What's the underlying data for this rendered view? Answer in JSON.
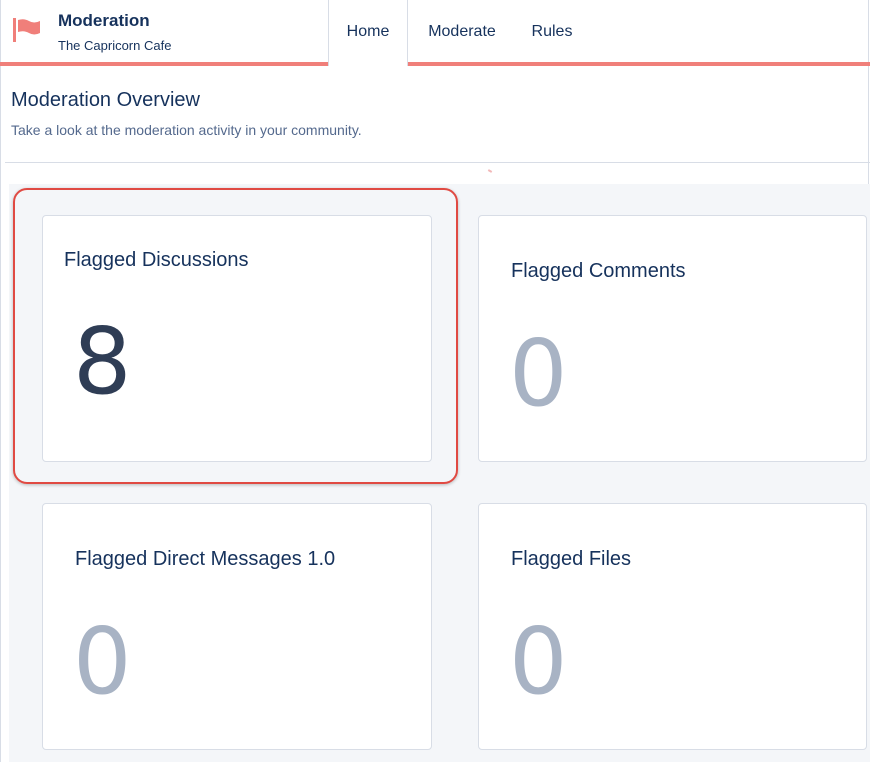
{
  "header": {
    "app_title": "Moderation",
    "app_subtitle": "The Capricorn Cafe",
    "icon": "flag-icon",
    "accent_color": "#f07f7a",
    "tabs": [
      {
        "label": "Home",
        "active": true
      },
      {
        "label": "Moderate",
        "active": false
      },
      {
        "label": "Rules",
        "active": false
      }
    ]
  },
  "overview": {
    "title": "Moderation Overview",
    "description": "Take a look at the moderation activity in your community."
  },
  "cards": [
    {
      "title": "Flagged Discussions",
      "count": "8",
      "highlighted": true
    },
    {
      "title": "Flagged Comments",
      "count": "0",
      "highlighted": false
    },
    {
      "title": "Flagged Direct Messages 1.0",
      "count": "0",
      "highlighted": false
    },
    {
      "title": "Flagged Files",
      "count": "0",
      "highlighted": false
    }
  ],
  "colors": {
    "text_primary": "#16325c",
    "highlight_border": "#e04a43",
    "zero_count": "#a8b3c4"
  }
}
